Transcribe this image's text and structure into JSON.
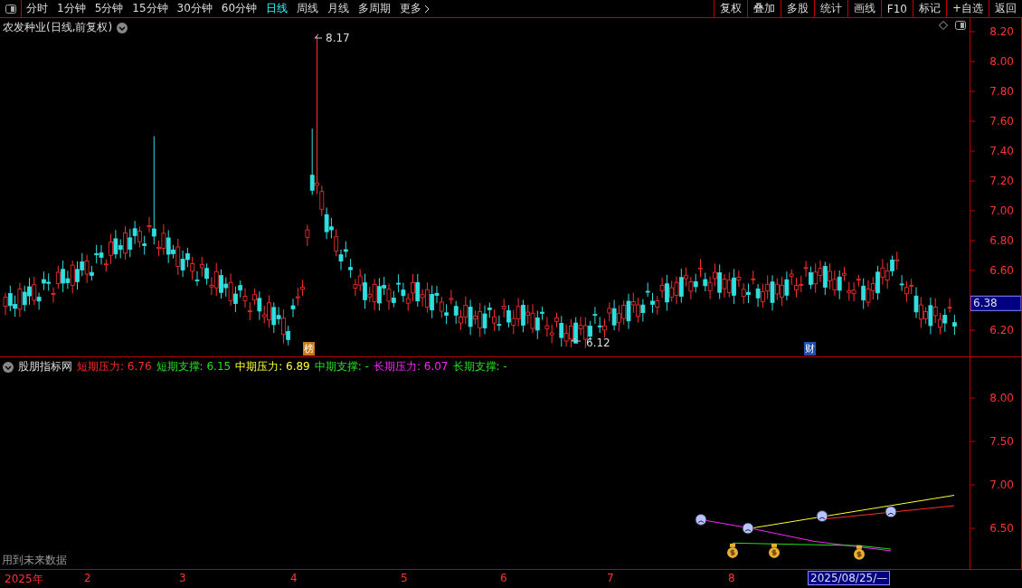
{
  "toolbar": {
    "periods": [
      {
        "label": "分时",
        "selected": false
      },
      {
        "label": "1分钟",
        "selected": false
      },
      {
        "label": "5分钟",
        "selected": false
      },
      {
        "label": "15分钟",
        "selected": false
      },
      {
        "label": "30分钟",
        "selected": false
      },
      {
        "label": "60分钟",
        "selected": false
      },
      {
        "label": "日线",
        "selected": true
      },
      {
        "label": "周线",
        "selected": false
      },
      {
        "label": "月线",
        "selected": false
      },
      {
        "label": "多周期",
        "selected": false
      }
    ],
    "more": "更多",
    "actions": [
      "复权",
      "叠加",
      "多股",
      "统计",
      "画线",
      "F10",
      "标记",
      "+自选",
      "返回"
    ]
  },
  "main_chart": {
    "title": "农发种业(日线,前复权)",
    "price_ticks": [
      "8.20",
      "8.00",
      "7.80",
      "7.60",
      "7.40",
      "7.20",
      "7.00",
      "6.80",
      "6.60",
      "6.20"
    ],
    "high_label": "8.17",
    "low_label": "6.12",
    "current_price": "6.38",
    "markers": [
      {
        "text": "榜",
        "color": "#c87a1a"
      },
      {
        "text": "财",
        "color": "#1d4fae"
      }
    ]
  },
  "indicator": {
    "name": "股朋指标网",
    "values": [
      {
        "label": "短期压力: 6.76",
        "color": "#ff2a2a"
      },
      {
        "label": "短期支撑: 6.15",
        "color": "#22e022"
      },
      {
        "label": "中期压力: 6.89",
        "color": "#ffff33"
      },
      {
        "label": "中期支撑: -",
        "color": "#22e022"
      },
      {
        "label": "长期压力: 6.07",
        "color": "#ff22ff"
      },
      {
        "label": "长期支撑: -",
        "color": "#22e022"
      }
    ],
    "ticks": [
      "8.00",
      "7.50",
      "7.00",
      "6.50"
    ],
    "note": "用到未来数据"
  },
  "time_axis": {
    "labels": [
      {
        "text": "2025年",
        "selected": false
      },
      {
        "text": "2",
        "selected": false
      },
      {
        "text": "3",
        "selected": false
      },
      {
        "text": "4",
        "selected": false
      },
      {
        "text": "5",
        "selected": false
      },
      {
        "text": "6",
        "selected": false
      },
      {
        "text": "7",
        "selected": false
      },
      {
        "text": "8",
        "selected": false
      },
      {
        "text": "2025/08/25/—",
        "selected": true
      }
    ]
  }
}
